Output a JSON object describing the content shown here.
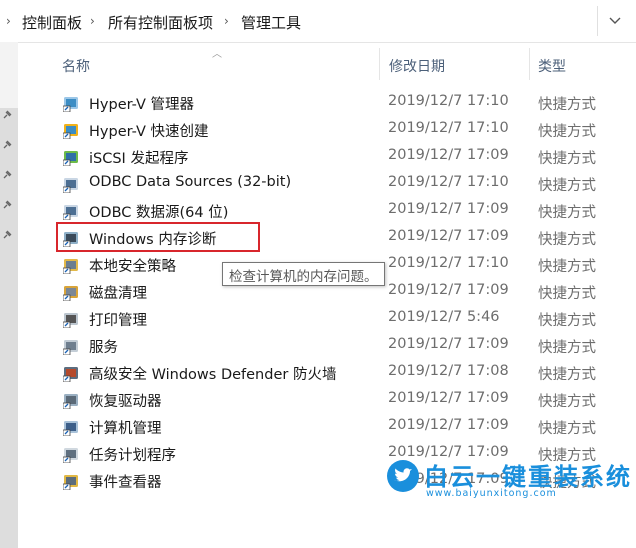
{
  "breadcrumb": [
    "控制面板",
    "所有控制面板项",
    "管理工具"
  ],
  "columns": {
    "name": "名称",
    "date": "修改日期",
    "type": "类型"
  },
  "rows": [
    {
      "name": "Hyper-V 管理器",
      "date": "2019/12/7 17:10",
      "type": "快捷方式",
      "icon": "hyperv-manager-icon"
    },
    {
      "name": "Hyper-V 快速创建",
      "date": "2019/12/7 17:10",
      "type": "快捷方式",
      "icon": "hyperv-quick-create-icon"
    },
    {
      "name": "iSCSI 发起程序",
      "date": "2019/12/7 17:09",
      "type": "快捷方式",
      "icon": "iscsi-icon"
    },
    {
      "name": "ODBC Data Sources (32-bit)",
      "date": "2019/12/7 17:10",
      "type": "快捷方式",
      "icon": "odbc-icon"
    },
    {
      "name": "ODBC 数据源(64 位)",
      "date": "2019/12/7 17:09",
      "type": "快捷方式",
      "icon": "odbc-icon"
    },
    {
      "name": "Windows 内存诊断",
      "date": "2019/12/7 17:09",
      "type": "快捷方式",
      "icon": "memory-diagnostic-icon"
    },
    {
      "name": "本地安全策略",
      "date": "2019/12/7 17:10",
      "type": "快捷方式",
      "icon": "security-policy-icon"
    },
    {
      "name": "磁盘清理",
      "date": "2019/12/7 17:09",
      "type": "快捷方式",
      "icon": "disk-cleanup-icon"
    },
    {
      "name": "打印管理",
      "date": "2019/12/7 5:46",
      "type": "快捷方式",
      "icon": "print-management-icon"
    },
    {
      "name": "服务",
      "date": "2019/12/7 17:09",
      "type": "快捷方式",
      "icon": "services-icon"
    },
    {
      "name": "高级安全 Windows Defender 防火墙",
      "date": "2019/12/7 17:08",
      "type": "快捷方式",
      "icon": "firewall-icon"
    },
    {
      "name": "恢复驱动器",
      "date": "2019/12/7 17:09",
      "type": "快捷方式",
      "icon": "recovery-drive-icon"
    },
    {
      "name": "计算机管理",
      "date": "2019/12/7 17:09",
      "type": "快捷方式",
      "icon": "computer-management-icon"
    },
    {
      "name": "任务计划程序",
      "date": "2019/12/7 17:09",
      "type": "快捷方式",
      "icon": "task-scheduler-icon"
    },
    {
      "name": "事件查看器",
      "date": "2019/12/7 17:09",
      "type": "快捷方式",
      "icon": "event-viewer-icon"
    }
  ],
  "tooltip": "检查计算机的内存问题。",
  "watermark": {
    "title": "白云一键重装系统",
    "url": "www.baiyunxitong.com"
  },
  "colors": {
    "highlight": "#d8262c",
    "watermark": "#1a8fdc",
    "header_text": "#4c607a"
  }
}
